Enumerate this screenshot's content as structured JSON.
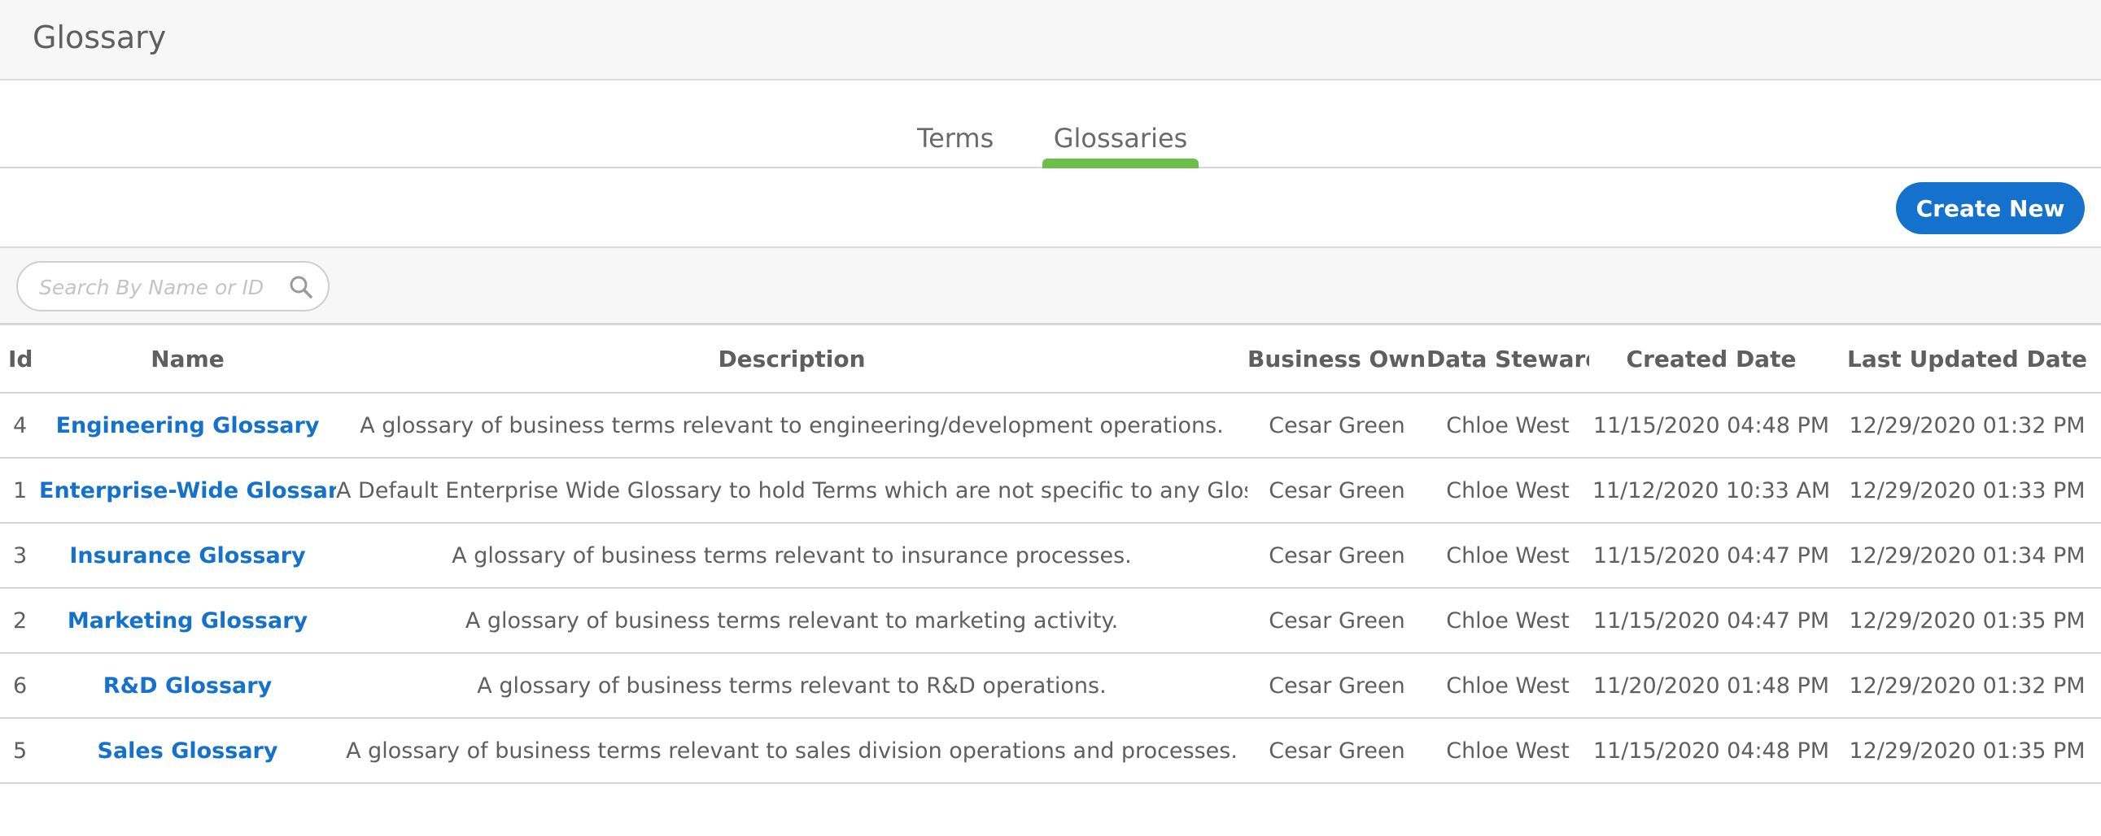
{
  "header": {
    "title": "Glossary"
  },
  "tabs": [
    {
      "label": "Terms",
      "active": false
    },
    {
      "label": "Glossaries",
      "active": true
    }
  ],
  "toolbar": {
    "create_label": "Create New"
  },
  "search": {
    "placeholder": "Search By Name or ID",
    "value": ""
  },
  "table": {
    "columns": [
      "Id",
      "Name",
      "Description",
      "Business Owner",
      "Data Steward",
      "Created Date",
      "Last Updated Date"
    ],
    "rows": [
      {
        "id": "4",
        "name": "Engineering Glossary",
        "description": "A glossary of business terms relevant to engineering/development operations.",
        "owner": "Cesar Green",
        "steward": "Chloe West",
        "created": "11/15/2020 04:48 PM",
        "updated": "12/29/2020 01:32 PM"
      },
      {
        "id": "1",
        "name": "Enterprise-Wide Glossary",
        "description": "A Default Enterprise Wide Glossary to hold Terms which are not specific to any Glossary",
        "owner": "Cesar Green",
        "steward": "Chloe West",
        "created": "11/12/2020 10:33 AM",
        "updated": "12/29/2020 01:33 PM"
      },
      {
        "id": "3",
        "name": "Insurance Glossary",
        "description": "A glossary of business terms relevant to insurance processes.",
        "owner": "Cesar Green",
        "steward": "Chloe West",
        "created": "11/15/2020 04:47 PM",
        "updated": "12/29/2020 01:34 PM"
      },
      {
        "id": "2",
        "name": "Marketing Glossary",
        "description": "A glossary of business terms relevant to marketing activity.",
        "owner": "Cesar Green",
        "steward": "Chloe West",
        "created": "11/15/2020 04:47 PM",
        "updated": "12/29/2020 01:35 PM"
      },
      {
        "id": "6",
        "name": "R&D Glossary",
        "description": "A glossary of business terms relevant to R&D operations.",
        "owner": "Cesar Green",
        "steward": "Chloe West",
        "created": "11/20/2020 01:48 PM",
        "updated": "12/29/2020 01:32 PM"
      },
      {
        "id": "5",
        "name": "Sales Glossary",
        "description": "A glossary of business terms relevant to sales division operations and processes.",
        "owner": "Cesar Green",
        "steward": "Chloe West",
        "created": "11/15/2020 04:48 PM",
        "updated": "12/29/2020 01:35 PM"
      }
    ]
  },
  "colors": {
    "accent": "#1572cc",
    "active_tab": "#6cc04a",
    "text": "#5f5f5f"
  },
  "icons": {
    "search": "search-icon"
  }
}
